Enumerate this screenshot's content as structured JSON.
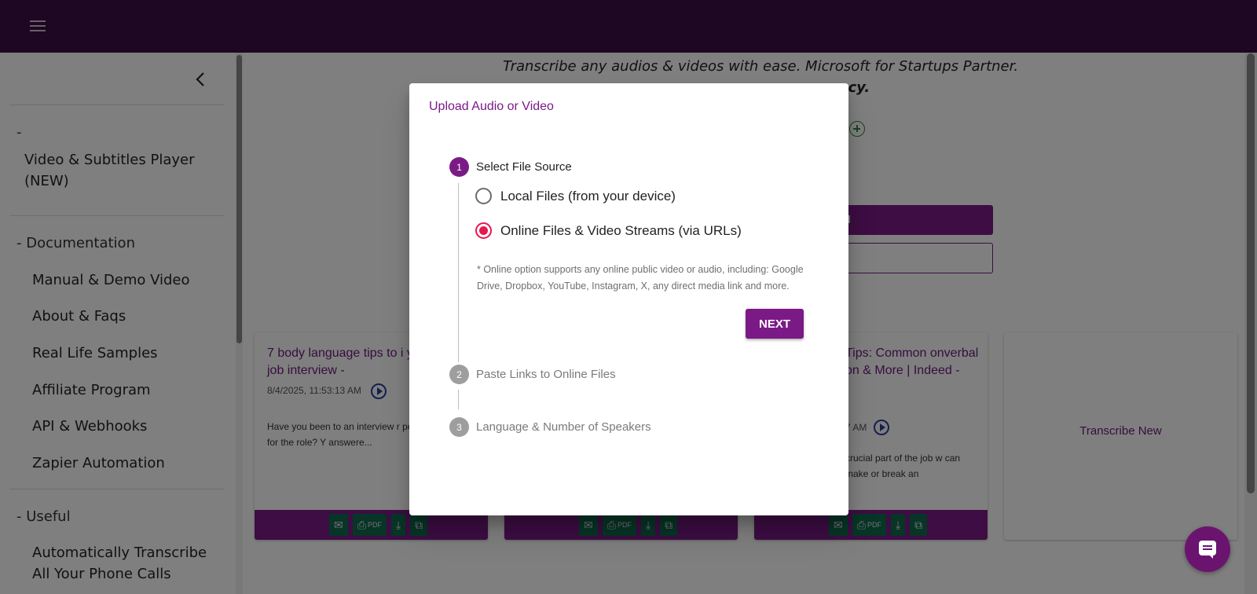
{
  "colors": {
    "topbar": "#3d0f45",
    "accent": "#7b1a87",
    "radio_checked": "#e5184f",
    "tool_button": "#0f6b4c"
  },
  "topbar": {
    "menu_icon": "hamburger-menu-icon"
  },
  "sidebar": {
    "collapse_icon": "chevron-left-icon",
    "groups": [
      {
        "heading": "-",
        "items": [
          "Video & Subtitles Player (NEW)"
        ]
      },
      {
        "heading": "- Documentation",
        "items": [
          "Manual & Demo Video",
          "About & Faqs",
          "Real Life Samples",
          "Affiliate Program",
          "API & Webhooks",
          "Zapier Automation"
        ]
      },
      {
        "heading": "- Useful",
        "items": [
          "Automatically Transcribe All Your Phone Calls"
        ]
      }
    ]
  },
  "main": {
    "tagline": "Transcribe any audios & videos with ease. Microsoft for Startups Partner.",
    "tagline_fragment": "curacy.",
    "primary_button_fragment": "N",
    "cards": [
      {
        "title": "7 body language tips to i your next job interview -",
        "date": "8/4/2025, 11:53:13 AM",
        "description": "Have you been to an interview r perfectly qualified for the role? Y answere..."
      },
      {
        "title": "",
        "date": "",
        "description": ""
      },
      {
        "title": "Tips: Common onverbal on & More | Indeed -",
        "date": "7 AM",
        "description": "crucial part of the job w can make or break an"
      }
    ],
    "card_tools": {
      "email": "email-icon",
      "print": "print-icon",
      "pdf": "PDF",
      "download": "download-icon",
      "open": "open-external-icon"
    },
    "transcribe_new": "Transcribe New"
  },
  "dialog": {
    "title": "Upload Audio or Video",
    "steps": [
      {
        "number": "1",
        "label": "Select File Source"
      },
      {
        "number": "2",
        "label": "Paste Links to Online Files"
      },
      {
        "number": "3",
        "label": "Language & Number of Speakers"
      }
    ],
    "options": [
      {
        "label": "Local Files (from your device)",
        "checked": false
      },
      {
        "label": "Online Files & Video Streams (via URLs)",
        "checked": true
      }
    ],
    "note": "* Online option supports any online public video or audio, including: Google Drive, Dropbox, YouTube, Instagram, X, any direct media link and more.",
    "next_label": "NEXT"
  },
  "chat": {
    "icon": "chat-bubble-icon"
  }
}
